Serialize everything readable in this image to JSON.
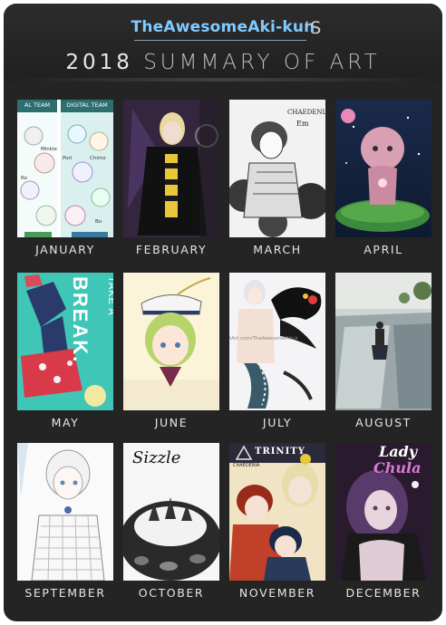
{
  "header": {
    "username": "TheAwesomeAki-kun",
    "apostrophe": "'S",
    "year": "2018",
    "title": "SUMMARY OF ART"
  },
  "months": [
    {
      "label": "JANUARY",
      "texts": [
        "AL TEAM",
        "DIGITAL TEAM",
        "Minkle",
        "Pori",
        "Chimo",
        "Ro",
        "Bo"
      ]
    },
    {
      "label": "FEBRUARY",
      "texts": []
    },
    {
      "label": "MARCH",
      "texts": [
        "CHAEDENIA",
        "Em"
      ]
    },
    {
      "label": "APRIL",
      "texts": []
    },
    {
      "label": "MAY",
      "texts": [
        "TAKE A",
        "BREAK."
      ]
    },
    {
      "label": "JUNE",
      "texts": []
    },
    {
      "label": "JULY",
      "texts": [
        "tArt.com/TheAwesomeAki-k"
      ]
    },
    {
      "label": "AUGUST",
      "texts": []
    },
    {
      "label": "SEPTEMBER",
      "texts": []
    },
    {
      "label": "OCTOBER",
      "texts": [
        "Sizzle"
      ]
    },
    {
      "label": "NOVEMBER",
      "texts": [
        "TRINITY",
        "CHAEDENIA"
      ]
    },
    {
      "label": "DECEMBER",
      "texts": [
        "Lady",
        "Chula"
      ]
    }
  ],
  "colors": {
    "frame": "#242424",
    "username": "#7ecbff",
    "label": "#e6e6e6"
  }
}
